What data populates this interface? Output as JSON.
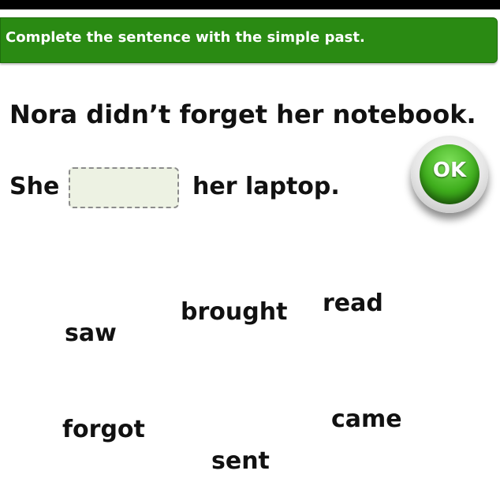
{
  "instruction": "Complete the sentence with the simple past.",
  "prompt_sentence": "Nora didn’t forget her notebook.",
  "answer_sentence": {
    "before": "She",
    "blank_value": "",
    "after": "her laptop."
  },
  "ok_button": {
    "label": "OK"
  },
  "choices": {
    "saw": "saw",
    "brought": "brought",
    "read": "read",
    "forgot": "forgot",
    "came": "came",
    "sent": "sent"
  },
  "colors": {
    "banner": "#2a8a13",
    "ok_button": "#3fae1d",
    "answer_box": "#edf2e3"
  }
}
